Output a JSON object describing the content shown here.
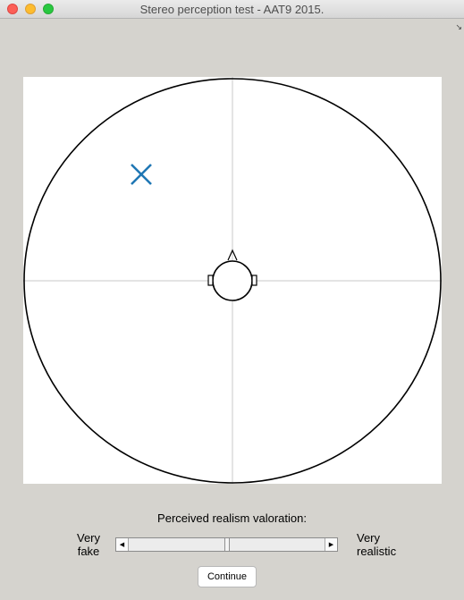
{
  "window": {
    "title": "Stereo perception test - AAT9 2015."
  },
  "plot": {
    "marker_icon": "x-marker",
    "marker_color": "#1f77b4",
    "head_icon": "listener-head"
  },
  "rating": {
    "title": "Perceived realism valoration:",
    "left_label_line1": "Very",
    "left_label_line2": "fake",
    "right_label_line1": "Very",
    "right_label_line2": "realistic",
    "value": 0.5
  },
  "buttons": {
    "continue": "Continue"
  }
}
